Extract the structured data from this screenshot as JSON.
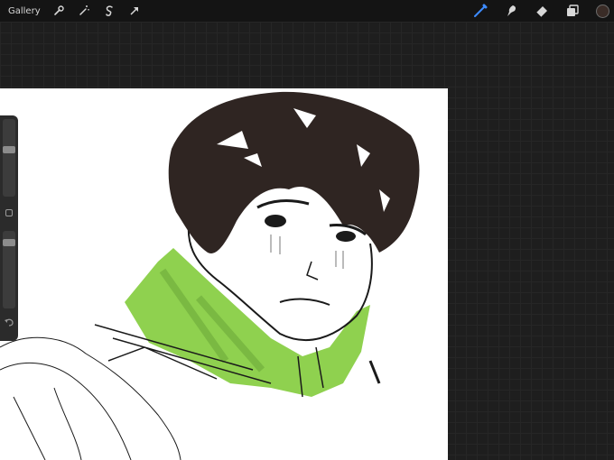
{
  "topbar": {
    "gallery_label": "Gallery",
    "left_tools": [
      "wrench-icon",
      "magic-wand-icon",
      "selection-icon",
      "transform-icon"
    ],
    "right_tools": [
      "brush-icon",
      "smudge-icon",
      "eraser-icon",
      "layers-icon"
    ],
    "active_tool": "brush-icon",
    "current_color": "#3a2c27"
  },
  "sidebar": {
    "brush_size": 0.35,
    "brush_opacity": 0.88
  },
  "canvas": {
    "accent_colors": {
      "hair": "#2f2522",
      "scarf": "#8fd14f",
      "line": "#1a1a1a"
    }
  }
}
